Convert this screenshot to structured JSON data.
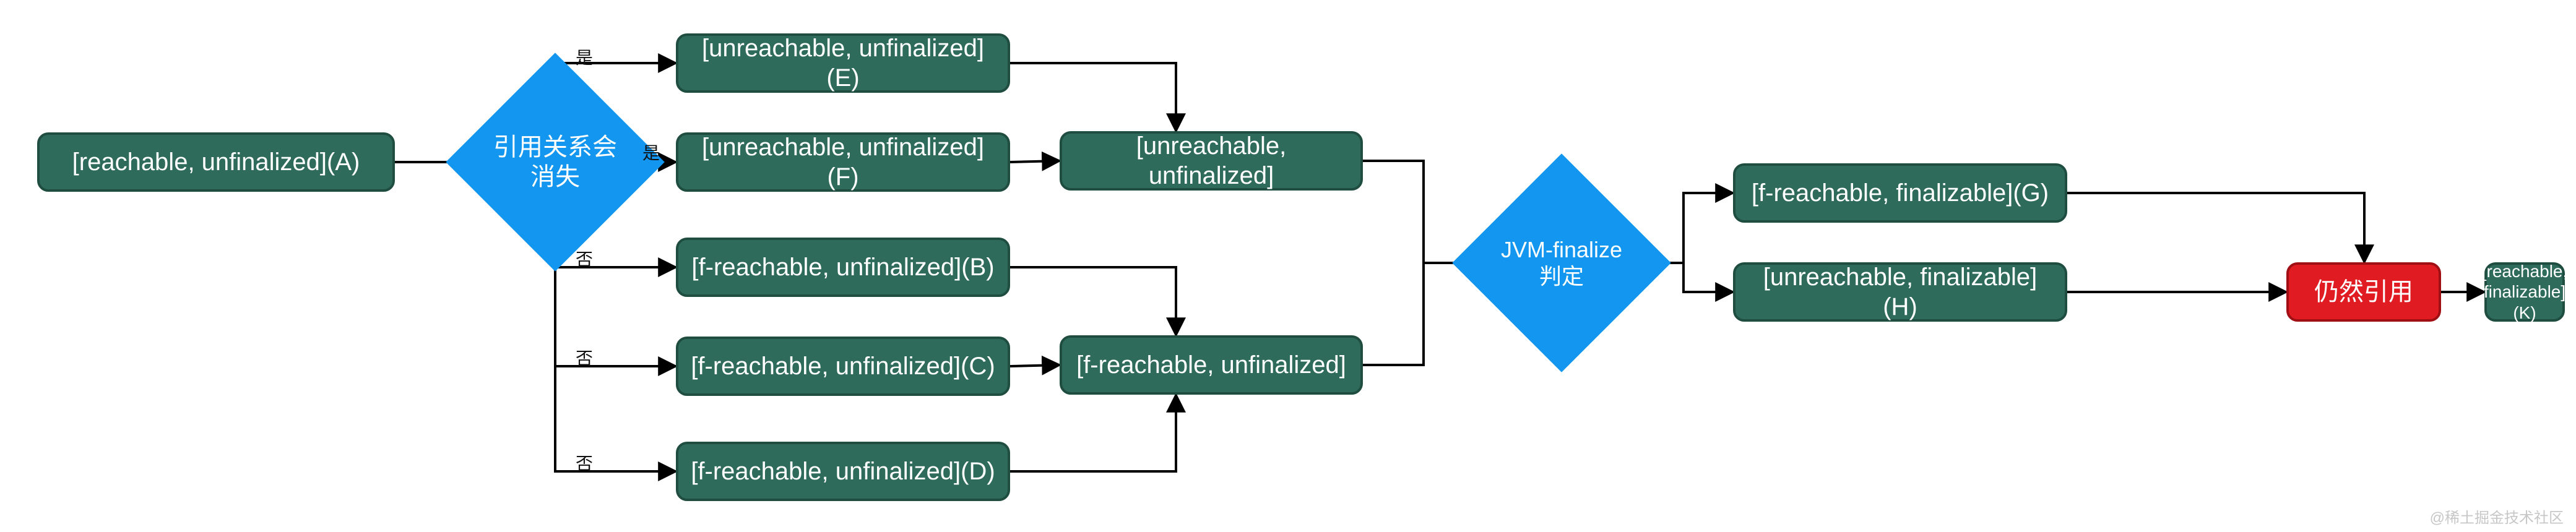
{
  "colors": {
    "teal_fill": "#2e6b5a",
    "teal_border": "#1f4d40",
    "blue": "#1296f0",
    "red_fill": "#e11b22",
    "red_border": "#a00f14",
    "arrow": "#000000"
  },
  "nodes": {
    "A": {
      "label": "[reachable, unfinalized](A)"
    },
    "D1": {
      "label": "引用关系会消失"
    },
    "E": {
      "label": "[unreachable, unfinalized](E)"
    },
    "F": {
      "label": "[unreachable, unfinalized](F)"
    },
    "B": {
      "label": "[f-reachable, unfinalized](B)"
    },
    "C": {
      "label": "[f-reachable, unfinalized](C)"
    },
    "D": {
      "label": "[f-reachable, unfinalized](D)"
    },
    "M1": {
      "label": "[unreachable, unfinalized]"
    },
    "M2": {
      "label": "[f-reachable, unfinalized]"
    },
    "D2": {
      "label": "JVM-finalize判定"
    },
    "G": {
      "label": "[f-reachable, finalizable](G)"
    },
    "H": {
      "label": "[unreachable, finalizable](H)"
    },
    "R": {
      "label": "仍然引用"
    },
    "K": {
      "label": "[reachable, finalizable](K)"
    }
  },
  "edge_labels": {
    "yes": "是",
    "no": "否"
  },
  "watermark": "@稀土掘金技术社区"
}
